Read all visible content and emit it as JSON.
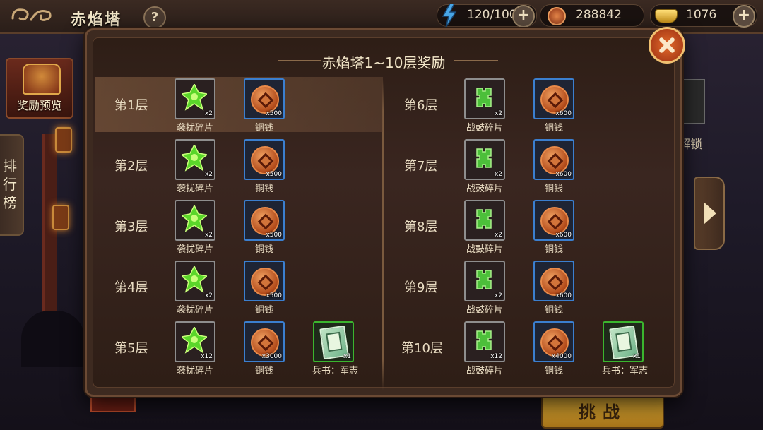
{
  "header": {
    "title": "赤焰塔",
    "help_label": "?",
    "stamina": "120/100",
    "copper": "288842",
    "gold": "1076",
    "plus_label": "+"
  },
  "sidebar": {
    "reward_preview_label": "奖励预览",
    "ranking_label": "排行榜"
  },
  "behind": {
    "unlock_label": "解锁",
    "challenge_label": "挑战"
  },
  "modal": {
    "title": "赤焰塔1~10层奖励",
    "floors_left": [
      {
        "label": "第1层",
        "items": [
          {
            "name": "袭扰碎片",
            "qty": "x2",
            "type": "shard"
          },
          {
            "name": "铜钱",
            "qty": "x500",
            "type": "coin"
          }
        ]
      },
      {
        "label": "第2层",
        "items": [
          {
            "name": "袭扰碎片",
            "qty": "x2",
            "type": "shard"
          },
          {
            "name": "铜钱",
            "qty": "x500",
            "type": "coin"
          }
        ]
      },
      {
        "label": "第3层",
        "items": [
          {
            "name": "袭扰碎片",
            "qty": "x2",
            "type": "shard"
          },
          {
            "name": "铜钱",
            "qty": "x500",
            "type": "coin"
          }
        ]
      },
      {
        "label": "第4层",
        "items": [
          {
            "name": "袭扰碎片",
            "qty": "x2",
            "type": "shard"
          },
          {
            "name": "铜钱",
            "qty": "x500",
            "type": "coin"
          }
        ]
      },
      {
        "label": "第5层",
        "items": [
          {
            "name": "袭扰碎片",
            "qty": "x12",
            "type": "shard"
          },
          {
            "name": "铜钱",
            "qty": "x3000",
            "type": "coin"
          },
          {
            "name": "兵书：军志",
            "qty": "x1",
            "type": "book"
          }
        ]
      }
    ],
    "floors_right": [
      {
        "label": "第6层",
        "items": [
          {
            "name": "战鼓碎片",
            "qty": "x2",
            "type": "drum"
          },
          {
            "name": "铜钱",
            "qty": "x600",
            "type": "coin"
          }
        ]
      },
      {
        "label": "第7层",
        "items": [
          {
            "name": "战鼓碎片",
            "qty": "x2",
            "type": "drum"
          },
          {
            "name": "铜钱",
            "qty": "x600",
            "type": "coin"
          }
        ]
      },
      {
        "label": "第8层",
        "items": [
          {
            "name": "战鼓碎片",
            "qty": "x2",
            "type": "drum"
          },
          {
            "name": "铜钱",
            "qty": "x600",
            "type": "coin"
          }
        ]
      },
      {
        "label": "第9层",
        "items": [
          {
            "name": "战鼓碎片",
            "qty": "x2",
            "type": "drum"
          },
          {
            "name": "铜钱",
            "qty": "x600",
            "type": "coin"
          }
        ]
      },
      {
        "label": "第10层",
        "items": [
          {
            "name": "战鼓碎片",
            "qty": "x12",
            "type": "drum"
          },
          {
            "name": "铜钱",
            "qty": "x4000",
            "type": "coin"
          },
          {
            "name": "兵书：军志",
            "qty": "x1",
            "type": "book"
          }
        ]
      }
    ]
  }
}
